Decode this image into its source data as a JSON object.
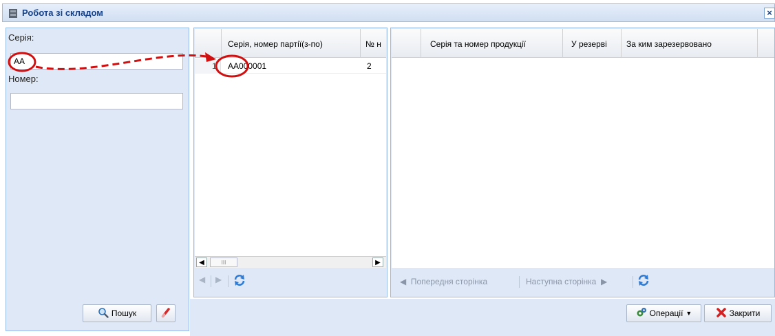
{
  "window": {
    "title": "Робота зі складом",
    "close_glyph": "×"
  },
  "filter": {
    "series_label": "Серія:",
    "series_value": "АА",
    "number_label": "Номер:",
    "number_value": "",
    "search_label": "Пошук",
    "search_icon": "magnifier-icon",
    "clear_icon": "eraser-icon"
  },
  "batch_grid": {
    "columns": [
      "",
      "Серія, номер партії(з-по)",
      "№ н"
    ],
    "rows": [
      {
        "index": "1",
        "batch": "АА000001",
        "num": "2"
      }
    ],
    "scroll_thumb": "III"
  },
  "product_grid": {
    "columns": [
      "",
      "Серія та номер продукції",
      "У резерві",
      "За ким зарезервовано"
    ],
    "prev_page": "Попередня сторінка",
    "next_page": "Наступна сторінка"
  },
  "footer": {
    "operations_label": "Операції",
    "close_label": "Закрити"
  },
  "colors": {
    "accent": "#15428b",
    "panel_bg": "#dfe8f6",
    "panel_border": "#99bbe8",
    "annotation_red": "#d01010"
  }
}
